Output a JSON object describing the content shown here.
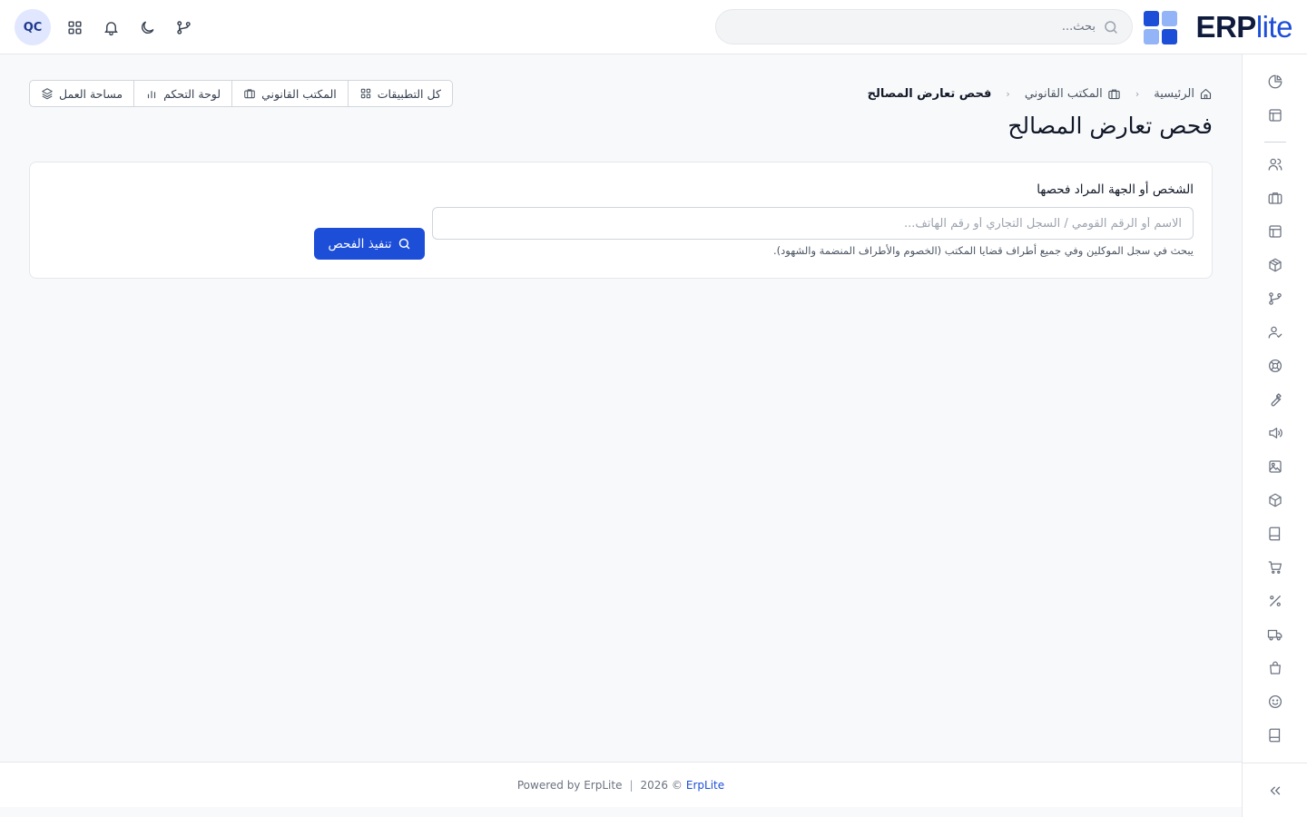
{
  "header": {
    "logo_text_main": "ERP",
    "logo_text_accent": "lite",
    "search_placeholder": "بحث...",
    "avatar_initials": "QC",
    "icons": [
      "git-branch-icon",
      "moon-icon",
      "bell-icon",
      "grid-icon"
    ]
  },
  "colors": {
    "brand": "#1d4ed8",
    "logo_dark": "#1d4ed8",
    "logo_light": "#93b4f7",
    "title_dark": "#0f1b3d"
  },
  "breadcrumb": {
    "home": "الرئيسية",
    "section": "المكتب القانوني",
    "current": "فحص تعارض المصالح"
  },
  "page_title": "فحص تعارض المصالح",
  "quick_links": {
    "all_apps": "كل التطبيقات",
    "legal_office": "المكتب القانوني",
    "dashboard": "لوحة التحكم",
    "workspace": "مساحة العمل"
  },
  "form": {
    "label": "الشخص أو الجهة المراد فحصها",
    "placeholder": "الاسم أو الرقم القومي / السجل التجاري أو رقم الهاتف...",
    "help": "يبحث في سجل الموكلين وفي جميع أطراف قضايا المكتب (الخصوم والأطراف المنضمة والشهود).",
    "submit": "تنفيذ الفحص"
  },
  "sidebar": {
    "items": [
      "pie-chart-icon",
      "layout-icon",
      "users-icon",
      "briefcase-icon",
      "layout-icon",
      "package-icon",
      "git-branch-icon",
      "user-check-icon",
      "life-buoy-icon",
      "wrench-icon",
      "megaphone-icon",
      "image-icon",
      "box-icon",
      "book-icon",
      "cart-icon",
      "percent-icon",
      "truck-icon",
      "shopping-bag-icon",
      "smile-icon",
      "book-icon",
      "map-icon"
    ],
    "collapse_icon": "chevrons-left-icon"
  },
  "footer": {
    "powered": "Powered by ErpLite",
    "separator": "|",
    "year": "2026 ©",
    "brand": "ErpLite"
  }
}
